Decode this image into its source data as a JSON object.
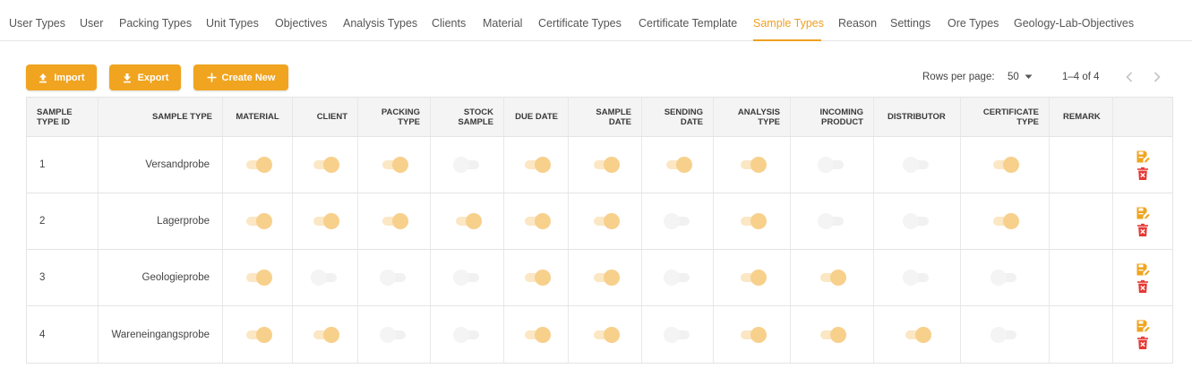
{
  "tabs": [
    {
      "label": "User Types"
    },
    {
      "label": "User"
    },
    {
      "label": "Packing Types"
    },
    {
      "label": "Unit Types"
    },
    {
      "label": "Objectives"
    },
    {
      "label": "Analysis Types"
    },
    {
      "label": "Clients"
    },
    {
      "label": "Material"
    },
    {
      "label": "Certificate Types"
    },
    {
      "label": "Certificate Template"
    },
    {
      "label": "Sample Types",
      "active": true
    },
    {
      "label": "Reason"
    },
    {
      "label": "Settings"
    },
    {
      "label": "Ore Types"
    },
    {
      "label": "Geology-Lab-Objectives"
    }
  ],
  "toolbar": {
    "import_label": "Import",
    "export_label": "Export",
    "create_label": "Create New"
  },
  "pagination": {
    "rows_per_page_label": "Rows per page:",
    "rows_per_page_value": "50",
    "range": "1–4 of 4"
  },
  "colors": {
    "accent": "#f0a41f",
    "toggle_on_knob": "#f7d08c",
    "toggle_on_track": "#fbe7c4",
    "delete": "#e53935"
  },
  "table": {
    "columns": [
      "SAMPLE TYPE ID",
      "SAMPLE TYPE",
      "MATERIAL",
      "CLIENT",
      "PACKING TYPE",
      "STOCK SAMPLE",
      "DUE DATE",
      "SAMPLE DATE",
      "SENDING DATE",
      "ANALYSIS TYPE",
      "INCOMING PRODUCT",
      "DISTRIBUTOR",
      "CERTIFICATE TYPE",
      "REMARK"
    ],
    "rows": [
      {
        "id": "1",
        "sample_type": "Versandprobe",
        "remark": "",
        "flags": [
          true,
          true,
          true,
          false,
          true,
          true,
          true,
          true,
          false,
          false,
          true
        ]
      },
      {
        "id": "2",
        "sample_type": "Lagerprobe",
        "remark": "",
        "flags": [
          true,
          true,
          true,
          true,
          true,
          true,
          false,
          true,
          false,
          false,
          true
        ]
      },
      {
        "id": "3",
        "sample_type": "Geologieprobe",
        "remark": "",
        "flags": [
          true,
          false,
          false,
          false,
          true,
          true,
          false,
          true,
          true,
          false,
          false
        ]
      },
      {
        "id": "4",
        "sample_type": "Wareneingangsprobe",
        "remark": "",
        "flags": [
          true,
          true,
          false,
          false,
          true,
          true,
          false,
          true,
          true,
          true,
          false
        ]
      }
    ]
  }
}
